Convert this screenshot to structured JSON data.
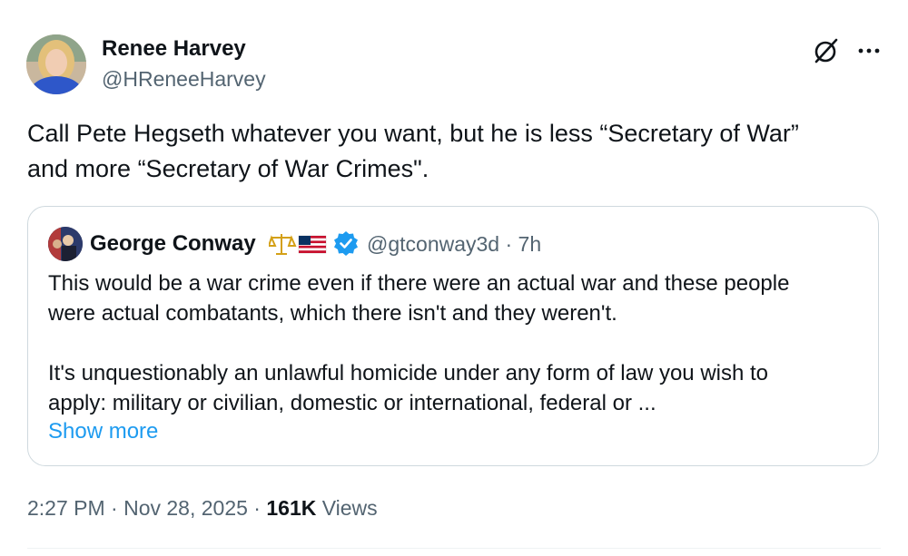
{
  "author": {
    "name": "Renee Harvey",
    "handle": "@HReneeHarvey",
    "avatar_icon": "user-avatar-photo"
  },
  "tweet": {
    "text_lines": [
      "Call Pete Hegseth whatever you want, but he is less “Secretary of War”",
      "and more “Secretary of War Crimes\"."
    ]
  },
  "quote": {
    "name": "George Conway",
    "emoji_icons": [
      "scales-icon",
      "us-flag-icon"
    ],
    "verified_icon": "verified-badge-icon",
    "handle_time": "@gtconway3d · 7h",
    "text_lines": [
      "This would be a war crime even if there were an actual war and these people",
      "were actual combatants, which there isn't and they weren't."
    ],
    "text_lines_2": [
      "It's unquestionably an unlawful homicide under any form of law you wish to",
      "apply:  military or civilian, domestic or international, federal or ..."
    ],
    "show_more": "Show more"
  },
  "meta": {
    "time_date": "2:27 PM · Nov 28, 2025 · ",
    "views_count": "161K",
    "views_label": " Views"
  },
  "colors": {
    "text": "#0f1419",
    "secondary": "#536471",
    "link": "#1d9bf0",
    "border": "#cfd9de"
  }
}
